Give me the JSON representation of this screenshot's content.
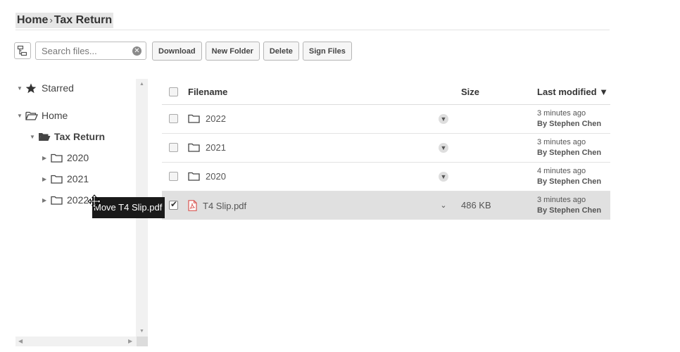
{
  "breadcrumb": {
    "items": [
      "Home",
      "Tax Return"
    ],
    "separator": "›"
  },
  "search": {
    "placeholder": "Search files..."
  },
  "toolbar": {
    "download": "Download",
    "new_folder": "New Folder",
    "delete": "Delete",
    "sign_files": "Sign Files"
  },
  "sidebar": {
    "starred": "Starred",
    "home": "Home",
    "tax_return": "Tax Return",
    "folders": [
      "2020",
      "2021",
      "2022"
    ]
  },
  "drag_tooltip": "Move T4 Slip.pdf",
  "table": {
    "headers": {
      "filename": "Filename",
      "size": "Size",
      "modified": "Last modified ▼"
    },
    "rows": [
      {
        "name": "2022",
        "type": "folder",
        "size": "",
        "modified": "3 minutes ago",
        "by": "By Stephen Chen",
        "selected": false
      },
      {
        "name": "2021",
        "type": "folder",
        "size": "",
        "modified": "3 minutes ago",
        "by": "By Stephen Chen",
        "selected": false
      },
      {
        "name": "2020",
        "type": "folder",
        "size": "",
        "modified": "4 minutes ago",
        "by": "By Stephen Chen",
        "selected": false
      },
      {
        "name": "T4 Slip.pdf",
        "type": "pdf",
        "size": "486 KB",
        "modified": "3 minutes ago",
        "by": "By Stephen Chen",
        "selected": true
      }
    ]
  },
  "icons": {
    "tree_toggle": "tree-view-icon",
    "clear": "clear-search-icon",
    "folder": "folder-icon",
    "pdf": "pdf-file-icon",
    "star": "star-icon",
    "move_cursor": "move-cursor-icon"
  },
  "colors": {
    "pdf_red": "#d9534f",
    "selected_row": "#e0e0e0",
    "tooltip_bg": "#1a1a1a"
  }
}
